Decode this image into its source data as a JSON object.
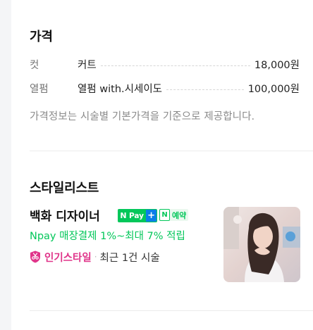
{
  "price": {
    "title": "가격",
    "rows": [
      {
        "category": "컷",
        "name": "커트",
        "value": "18,000원"
      },
      {
        "category": "열펌",
        "name": "열펌 with.시세이도",
        "value": "100,000원"
      }
    ],
    "note": "가격정보는 시술별 기본가격을 기준으로 제공합니다."
  },
  "stylist": {
    "title": "스타일리스트",
    "name": "백화 디자이너",
    "npay_badge": {
      "n": "N",
      "pay": "Pay",
      "plus": "+"
    },
    "reserve_badge": {
      "n": "N",
      "label": "예약"
    },
    "npay_benefit": "Npay 매장결제 1%~최대 7% 적립",
    "popular_label": "인기스타일",
    "popular_count": "최근 1건 시술",
    "photo_icon": "stylist-profile-photo"
  },
  "colors": {
    "naver_green": "#03c75a",
    "npay_plus_blue": "#0a7ee8",
    "popular_pink": "#e0358a"
  }
}
